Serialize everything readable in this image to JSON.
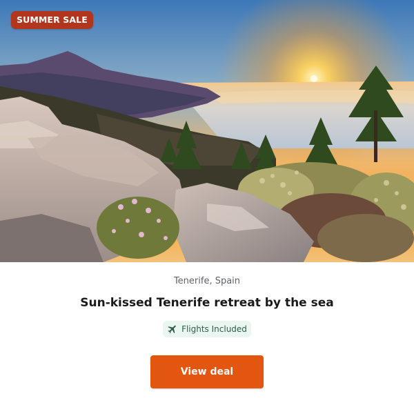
{
  "badge": {
    "label": "SUMMER SALE"
  },
  "offer": {
    "location": "Tenerife, Spain",
    "title": "Sun-kissed Tenerife retreat by the sea",
    "feature": {
      "icon": "airplane-icon",
      "label": "Flights Included"
    },
    "cta_label": "View deal"
  },
  "colors": {
    "badge_bg": "#b2361e",
    "cta_bg": "#e2560f",
    "pill_bg": "#eaf7f0",
    "pill_text": "#2f5d49"
  }
}
